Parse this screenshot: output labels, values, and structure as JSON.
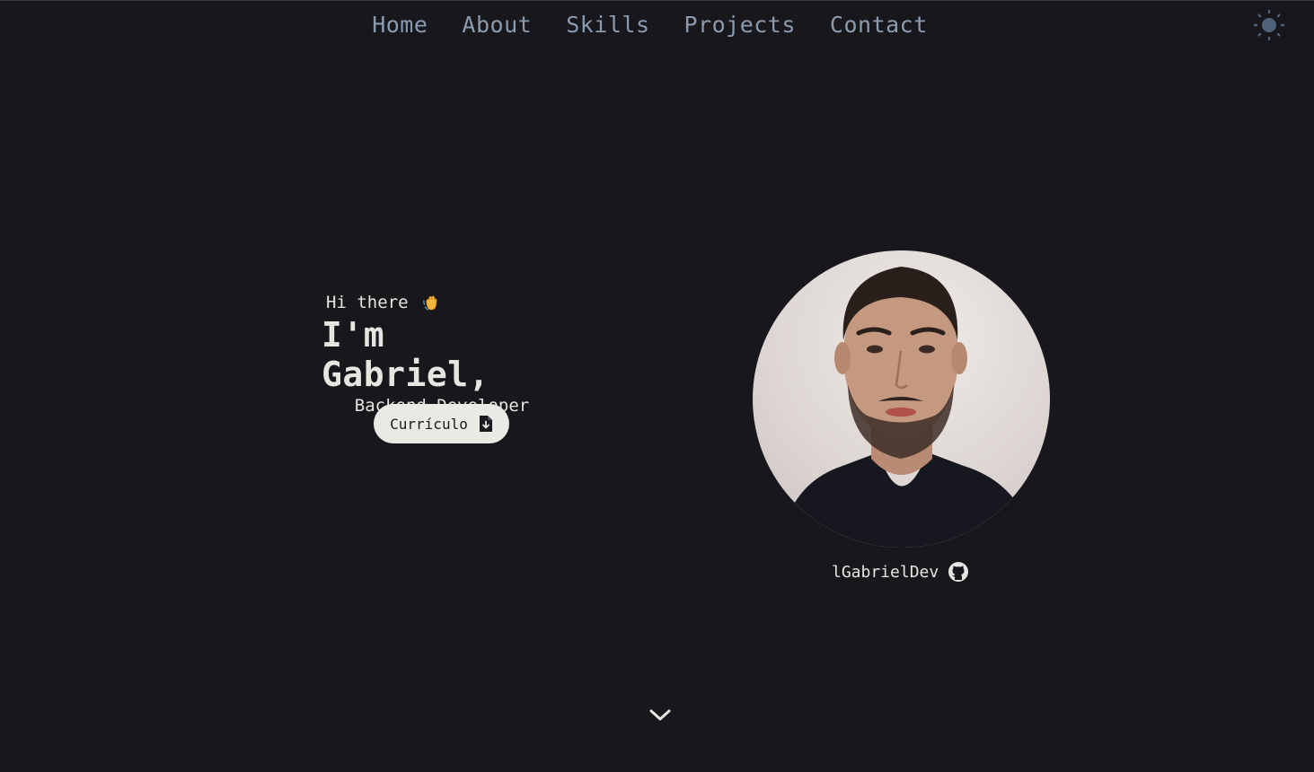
{
  "nav": {
    "items": [
      {
        "label": "Home"
      },
      {
        "label": "About"
      },
      {
        "label": "Skills"
      },
      {
        "label": "Projects"
      },
      {
        "label": "Contact"
      }
    ]
  },
  "theme_toggle": {
    "icon": "sun-icon"
  },
  "hero": {
    "greeting": "Hi there",
    "greeting_icon": "waving-hand-icon",
    "name": "I'm Gabriel,",
    "role": "Backend Developer",
    "cv_button": {
      "label": "Currículo",
      "icon": "file-download-icon"
    }
  },
  "profile": {
    "photo": "profile-photo",
    "github_username": "lGabrielDev",
    "github_icon": "github-icon"
  },
  "scroll_icon": "chevron-down-icon",
  "colors": {
    "background": "#18171c",
    "nav_text": "#8a9bb0",
    "text": "#e7e5df",
    "button_bg": "#ebe9e4",
    "button_text": "#1a1a1f"
  }
}
